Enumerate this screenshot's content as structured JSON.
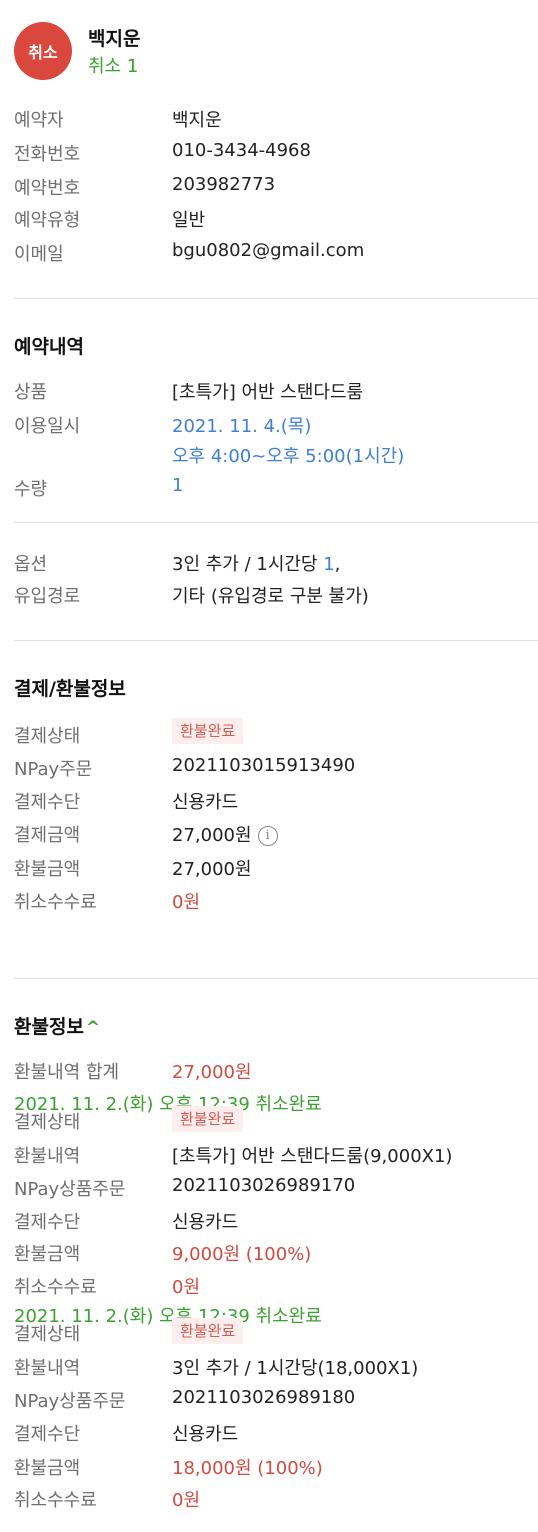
{
  "header": {
    "avatar_text": "취소",
    "name": "백지운",
    "status": "취소 1"
  },
  "booker": {
    "rows": [
      {
        "label": "예약자",
        "value": "백지운"
      },
      {
        "label": "전화번호",
        "value": "010-3434-4968"
      },
      {
        "label": "예약번호",
        "value": "203982773"
      },
      {
        "label": "예약유형",
        "value": "일반"
      },
      {
        "label": "이메일",
        "value": "bgu0802@gmail.com"
      }
    ]
  },
  "reservation": {
    "title": "예약내역",
    "product_label": "상품",
    "product_value": "[초특가] 어반 스탠다드룸",
    "date_label": "이용일시",
    "date_line1": "2021. 11. 4.(목)",
    "date_line2": "오후 4:00~오후 5:00(1시간)",
    "qty_label": "수량",
    "qty_value": "1",
    "option_label": "옵션",
    "option_value_prefix": "3인 추가 / 1시간당 ",
    "option_value_qty": "1",
    "option_value_suffix": ",",
    "channel_label": "유입경로",
    "channel_value": "기타 (유입경로 구분 불가)"
  },
  "payment": {
    "title": "결제/환불정보",
    "status_label": "결제상태",
    "status_badge": "환불완료",
    "npay_label": "NPay주문",
    "npay_value": "2021103015913490",
    "method_label": "결제수단",
    "method_value": "신용카드",
    "amount_label": "결제금액",
    "amount_value": "27,000원",
    "info_icon": "i",
    "refund_label": "환불금액",
    "refund_value": "27,000원",
    "fee_label": "취소수수료",
    "fee_value": "0원"
  },
  "refund": {
    "title": "환불정보",
    "toggle_icon": "^",
    "total_label": "환불내역 합계",
    "total_value": "27,000원",
    "entries": [
      {
        "datetime": "2021. 11. 2.(화) 오후 12:39 취소완료",
        "status_label": "결제상태",
        "status_badge": "환불완료",
        "detail_label": "환불내역",
        "detail_value": "[초특가] 어반 스탠다드룸(9,000X1)",
        "order_label": "NPay상품주문",
        "order_value": "2021103026989170",
        "method_label": "결제수단",
        "method_value": "신용카드",
        "amount_label": "환불금액",
        "amount_value": "9,000원 (100%)",
        "fee_label": "취소수수료",
        "fee_value": "0원"
      },
      {
        "datetime": "2021. 11. 2.(화) 오후 12:39 취소완료",
        "status_label": "결제상태",
        "status_badge": "환불완료",
        "detail_label": "환불내역",
        "detail_value": "3인 추가 / 1시간당(18,000X1)",
        "order_label": "NPay상품주문",
        "order_value": "2021103026989180",
        "method_label": "결제수단",
        "method_value": "신용카드",
        "amount_label": "환불금액",
        "amount_value": "18,000원 (100%)",
        "fee_label": "취소수수료",
        "fee_value": "0원"
      }
    ]
  },
  "colors": {
    "avatar": "#d9473d",
    "green": "#3aa22e",
    "blue": "#3f7fd4",
    "red": "#d24b41",
    "badge_bg": "#fdeeee"
  }
}
